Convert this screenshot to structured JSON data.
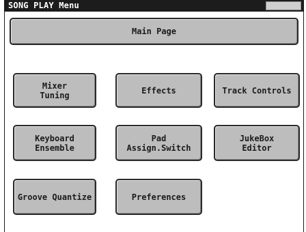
{
  "window": {
    "title": "SONG PLAY Menu"
  },
  "buttons": {
    "main_page": "Main Page",
    "mixer_tuning": "Mixer\nTuning",
    "effects": "Effects",
    "track_controls": "Track Controls",
    "keyboard_ensemble": "Keyboard\nEnsemble",
    "pad_assign_switch": "Pad\nAssign.Switch",
    "jukebox_editor": "JukeBox\nEditor",
    "groove_quantize": "Groove Quantize",
    "preferences": "Preferences"
  }
}
